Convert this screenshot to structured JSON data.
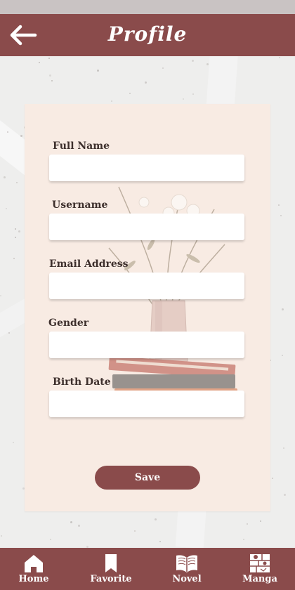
{
  "header": {
    "back_icon": "arrow-left-icon",
    "title": "Profile"
  },
  "form": {
    "fields": [
      {
        "label": "Full Name",
        "value": "",
        "placeholder": ""
      },
      {
        "label": "Username",
        "value": "",
        "placeholder": ""
      },
      {
        "label": "Email Address",
        "value": "",
        "placeholder": ""
      },
      {
        "label": "Gender",
        "value": "",
        "placeholder": ""
      },
      {
        "label": "Birth Date",
        "value": "",
        "placeholder": ""
      }
    ],
    "save_label": "Save"
  },
  "nav": {
    "items": [
      {
        "label": "Home",
        "icon": "home-icon"
      },
      {
        "label": "Favorite",
        "icon": "bookmark-icon"
      },
      {
        "label": "Novel",
        "icon": "open-book-icon"
      },
      {
        "label": "Manga",
        "icon": "manga-icon"
      }
    ]
  },
  "colors": {
    "primary": "#8a4b4b",
    "card": "#f8ebe3",
    "background": "#eeeeed",
    "status_bar": "#c9c3c3"
  }
}
